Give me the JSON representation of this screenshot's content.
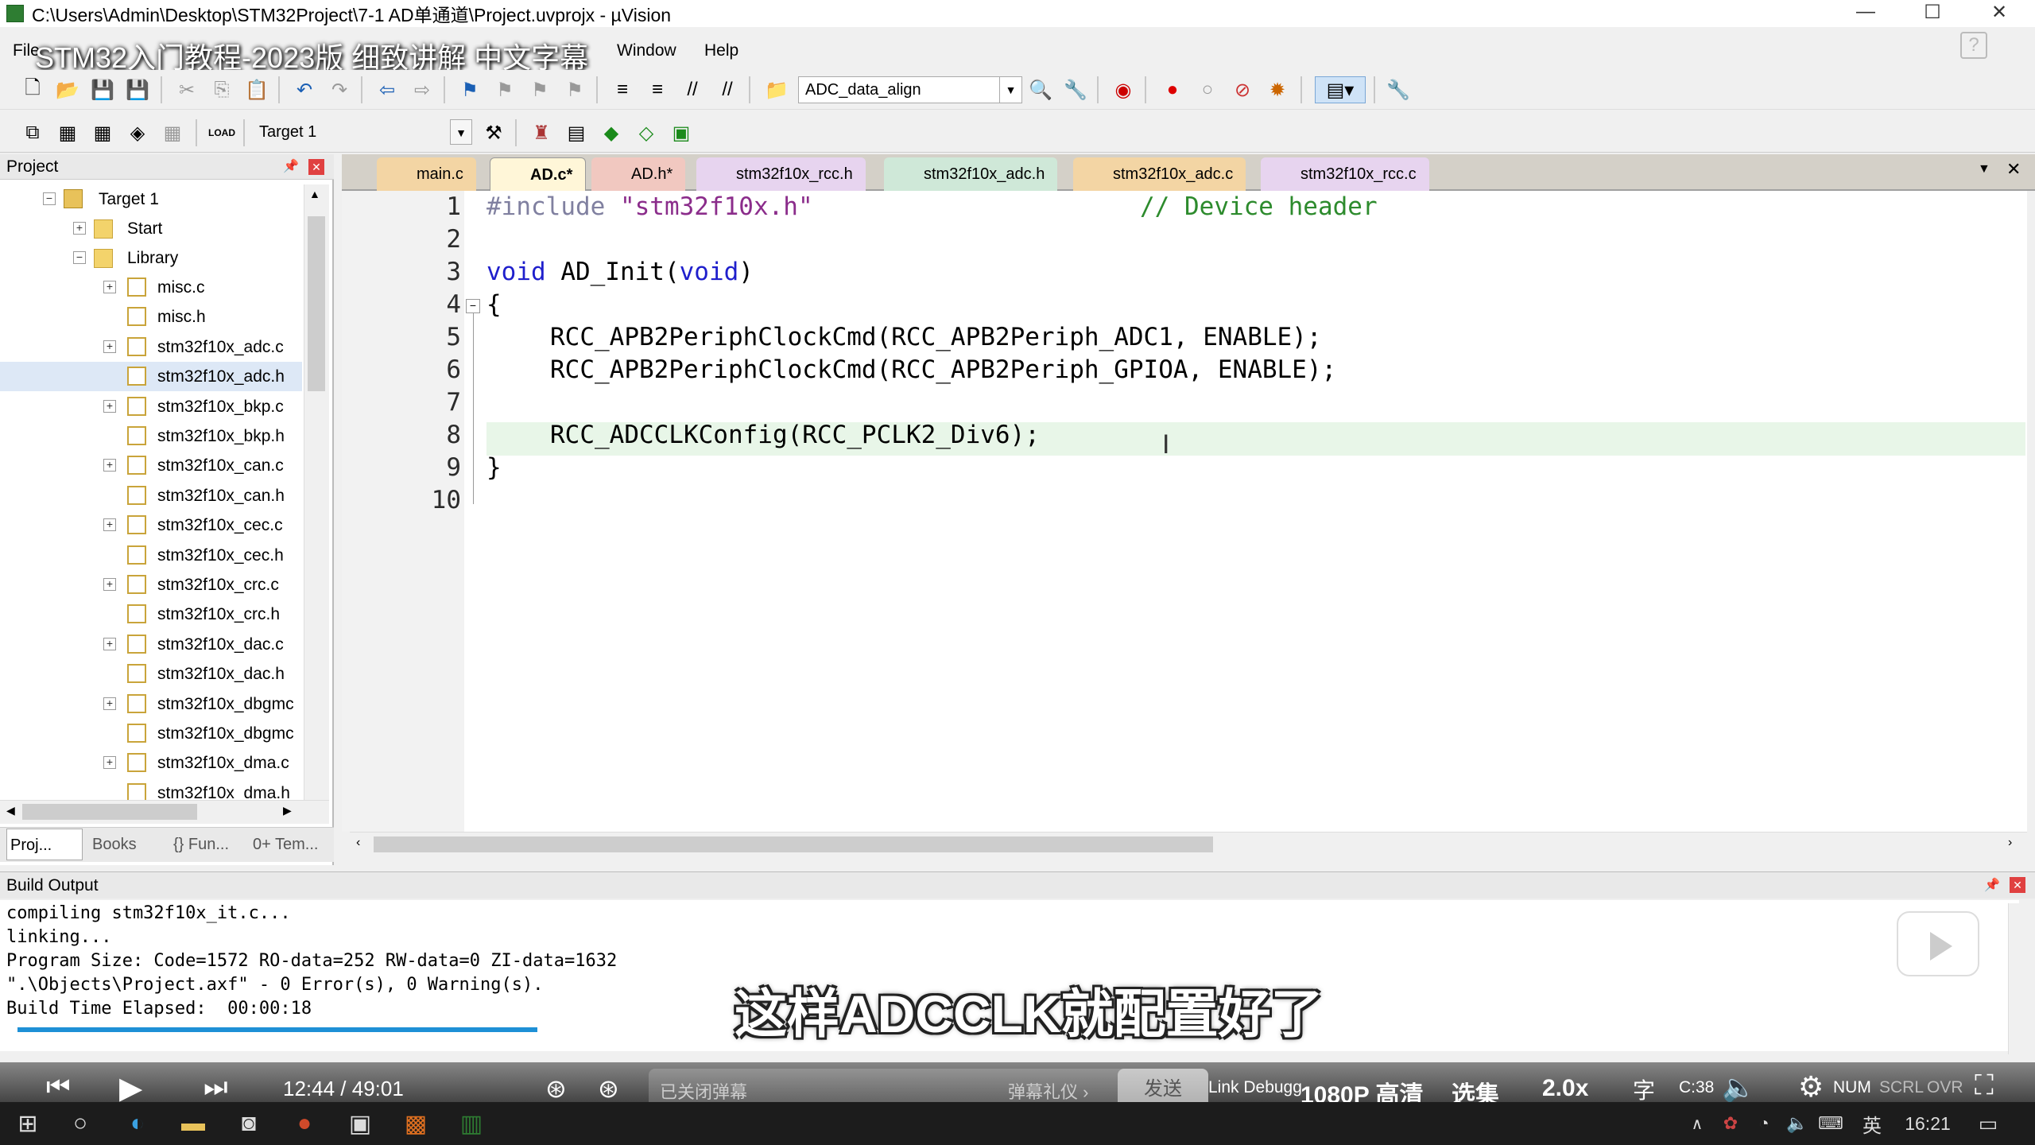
{
  "window": {
    "title": "C:\\Users\\Admin\\Desktop\\STM32Project\\7-1 AD单通道\\Project.uvprojx - µVision",
    "minimize": "—",
    "maximize": "☐",
    "close": "✕"
  },
  "overlay_title": "STM32入门教程-2023版 细致讲解 中文字幕",
  "menu": {
    "file": "File",
    "window": "Window",
    "help": "Help"
  },
  "toolbar": {
    "find_combo": "ADC_data_align",
    "target_combo": "Target 1"
  },
  "project_panel": {
    "title": "Project",
    "target": "Target 1",
    "groups": [
      "Start",
      "Library"
    ],
    "files": [
      "misc.c",
      "misc.h",
      "stm32f10x_adc.c",
      "stm32f10x_adc.h",
      "stm32f10x_bkp.c",
      "stm32f10x_bkp.h",
      "stm32f10x_can.c",
      "stm32f10x_can.h",
      "stm32f10x_cec.c",
      "stm32f10x_cec.h",
      "stm32f10x_crc.c",
      "stm32f10x_crc.h",
      "stm32f10x_dac.c",
      "stm32f10x_dac.h",
      "stm32f10x_dbgmc",
      "stm32f10x_dbgmc",
      "stm32f10x_dma.c",
      "stm32f10x_dma.h"
    ],
    "tabs": [
      "Proj...",
      "Books",
      "{} Fun...",
      "0+ Tem..."
    ]
  },
  "editor": {
    "tabs": [
      "main.c",
      "AD.c*",
      "AD.h*",
      "stm32f10x_rcc.h",
      "stm32f10x_adc.h",
      "stm32f10x_adc.c",
      "stm32f10x_rcc.c"
    ],
    "active_tab": "AD.c*",
    "line_numbers": [
      "1",
      "2",
      "3",
      "4",
      "5",
      "6",
      "7",
      "8",
      "9",
      "10"
    ],
    "lines": {
      "l1_pp": "#include ",
      "l1_str": "\"stm32f10x.h\"",
      "l1_cm": "// Device header",
      "l3_kw1": "void",
      "l3_mid": " AD_Init(",
      "l3_kw2": "void",
      "l3_end": ")",
      "l4": "{",
      "l5": "RCC_APB2PeriphClockCmd(RCC_APB2Periph_ADC1, ENABLE);",
      "l6": "RCC_APB2PeriphClockCmd(RCC_APB2Periph_GPIOA, ENABLE);",
      "l8": "RCC_ADCCLKConfig(RCC_PCLK2_Div6);",
      "l9": "}"
    }
  },
  "build_output": {
    "title": "Build Output",
    "lines": [
      "compiling stm32f10x_it.c...",
      "linking...",
      "Program Size: Code=1572 RO-data=252 RW-data=0 ZI-data=1632",
      "\".\\Objects\\Project.axf\" - 0 Error(s), 0 Warning(s).",
      "Build Time Elapsed:  00:00:18"
    ]
  },
  "subtitle": "这样ADCCLK就配置好了",
  "video": {
    "time": "12:44 / 49:01",
    "danmu_placeholder": "已关闭弹幕",
    "danmu_gift": "弹幕礼仪 ›",
    "send": "发送",
    "status_left": "Link Debugg",
    "quality": "1080P 高清",
    "episodes": "选集",
    "speed": "2.0x",
    "col": "C:38",
    "num": "NUM",
    "scrl": "SCRL",
    "ovr": "OVR"
  },
  "taskbar": {
    "lang": "英",
    "clock": "16:21"
  },
  "colors": {
    "highlight_line": "#e8f6e8",
    "keyword": "#1f1fcc",
    "string": "#8b2d8b",
    "comment": "#2d8b2d",
    "progress": "#1e90d6"
  }
}
